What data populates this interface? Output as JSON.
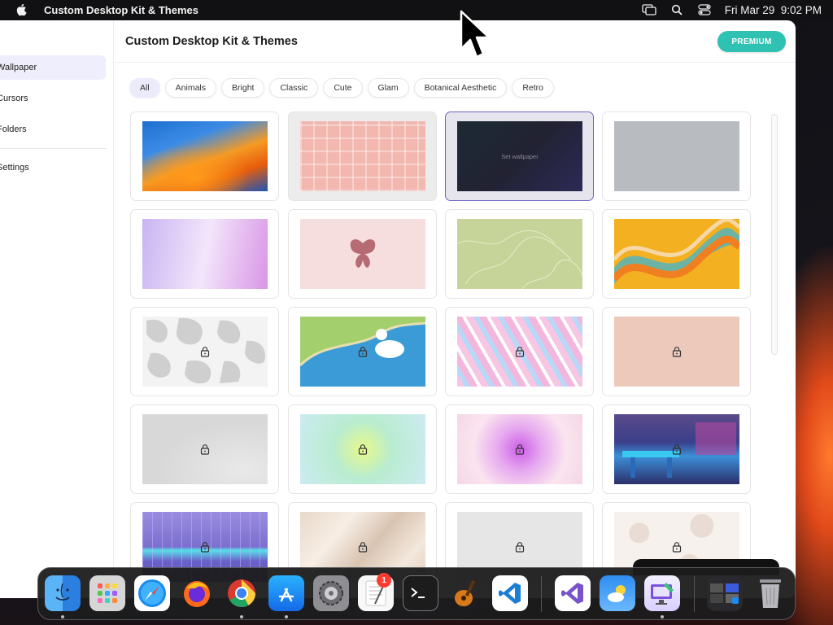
{
  "menubar": {
    "app_name": "Custom Desktop Kit & Themes",
    "datetime": "Fri Mar 29  9:02 PM"
  },
  "sidebar": {
    "items": [
      {
        "label": "Wallpaper",
        "active": true
      },
      {
        "label": "Cursors"
      },
      {
        "label": "Folders"
      },
      {
        "label": "Settings"
      }
    ]
  },
  "header": {
    "title": "Custom Desktop Kit & Themes",
    "premium_label": "PREMIUM"
  },
  "categories": [
    "All",
    "Animals",
    "Bright",
    "Classic",
    "Cute",
    "Glam",
    "Botanical Aesthetic",
    "Retro"
  ],
  "grid": {
    "selected_thumb_text": "Set wallpaper",
    "items": [
      {
        "name": "orange-waves",
        "locked": false
      },
      {
        "name": "pink-plaid",
        "locked": false
      },
      {
        "name": "neon-dark",
        "locked": false
      },
      {
        "name": "grey-solid",
        "locked": false
      },
      {
        "name": "lavender-gradient",
        "locked": false
      },
      {
        "name": "butterfly-pink",
        "locked": false
      },
      {
        "name": "sage-line-art",
        "locked": false
      },
      {
        "name": "retro-waves",
        "locked": false
      },
      {
        "name": "cow-print",
        "locked": true
      },
      {
        "name": "duck-pond",
        "locked": true
      },
      {
        "name": "zebra-pastel",
        "locked": true
      },
      {
        "name": "peach-solid",
        "locked": true
      },
      {
        "name": "grey-marble",
        "locked": true
      },
      {
        "name": "mint-glow",
        "locked": true
      },
      {
        "name": "purple-aura",
        "locked": true
      },
      {
        "name": "neon-room",
        "locked": true
      },
      {
        "name": "retro-grid",
        "locked": true
      },
      {
        "name": "beige-silk",
        "locked": true
      },
      {
        "name": "light-grey",
        "locked": true
      },
      {
        "name": "beige-spots",
        "locked": true
      }
    ]
  },
  "dock": {
    "badge_count": "1",
    "apps": [
      "Finder",
      "Launchpad",
      "Safari",
      "Firefox",
      "Chrome",
      "App Store",
      "System Settings",
      "TextEdit",
      "Terminal",
      "GarageBand",
      "VS Code",
      "Visual Studio",
      "Weather",
      "Custom Desktop Kit",
      "Window Preview",
      "Trash"
    ]
  }
}
